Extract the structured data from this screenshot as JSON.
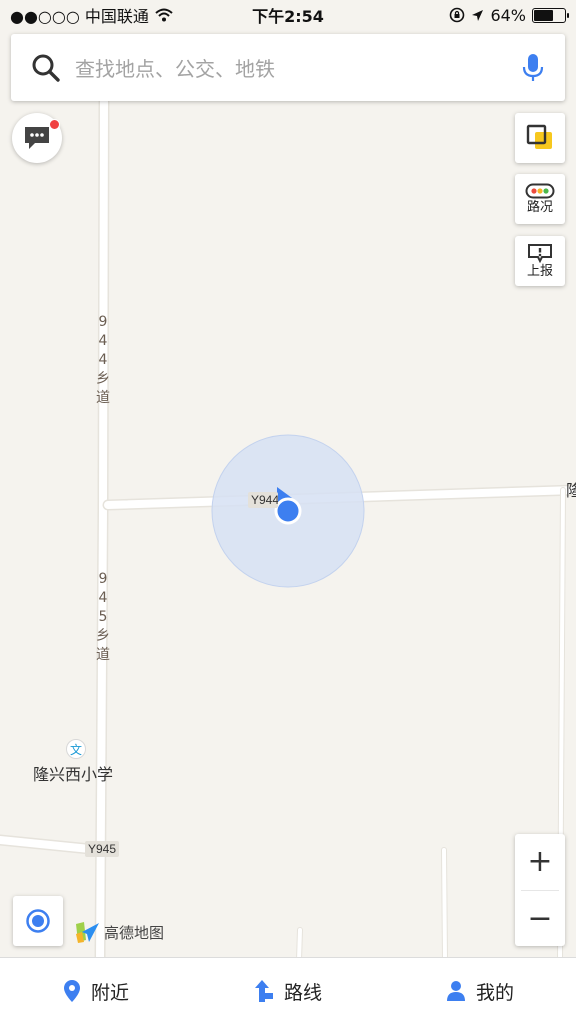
{
  "status_bar": {
    "carrier": "●●○○○ 中国联通",
    "time": "下午2:54",
    "battery_percent": "64%",
    "battery_level": 0.64
  },
  "search": {
    "placeholder": "查找地点、公交、地铁"
  },
  "tools": {
    "traffic_label": "路况",
    "report_label": "上报"
  },
  "map": {
    "road_labels": {
      "road_944_vertical": [
        "9",
        "4",
        "4",
        "乡",
        "道"
      ],
      "road_945_vertical": [
        "9",
        "4",
        "5",
        "乡",
        "道"
      ],
      "shield_y944": "Y944",
      "shield_y945": "Y945"
    },
    "poi_school": "隆兴西小学",
    "poi_school_glyph": "文",
    "edge_label": "隆"
  },
  "brand": {
    "name": "高德地图"
  },
  "zoom": {
    "in": "+",
    "out": "−"
  },
  "nav": {
    "items": [
      {
        "label": "附近",
        "icon": "location-pin-icon"
      },
      {
        "label": "路线",
        "icon": "route-arrow-icon"
      },
      {
        "label": "我的",
        "icon": "person-icon"
      }
    ]
  },
  "colors": {
    "accent_blue": "#3d7ff0",
    "location_circle": "#d6e1f3",
    "map_bg": "#f5f3ee",
    "road": "#ffffff",
    "badge_red": "#f04141"
  }
}
